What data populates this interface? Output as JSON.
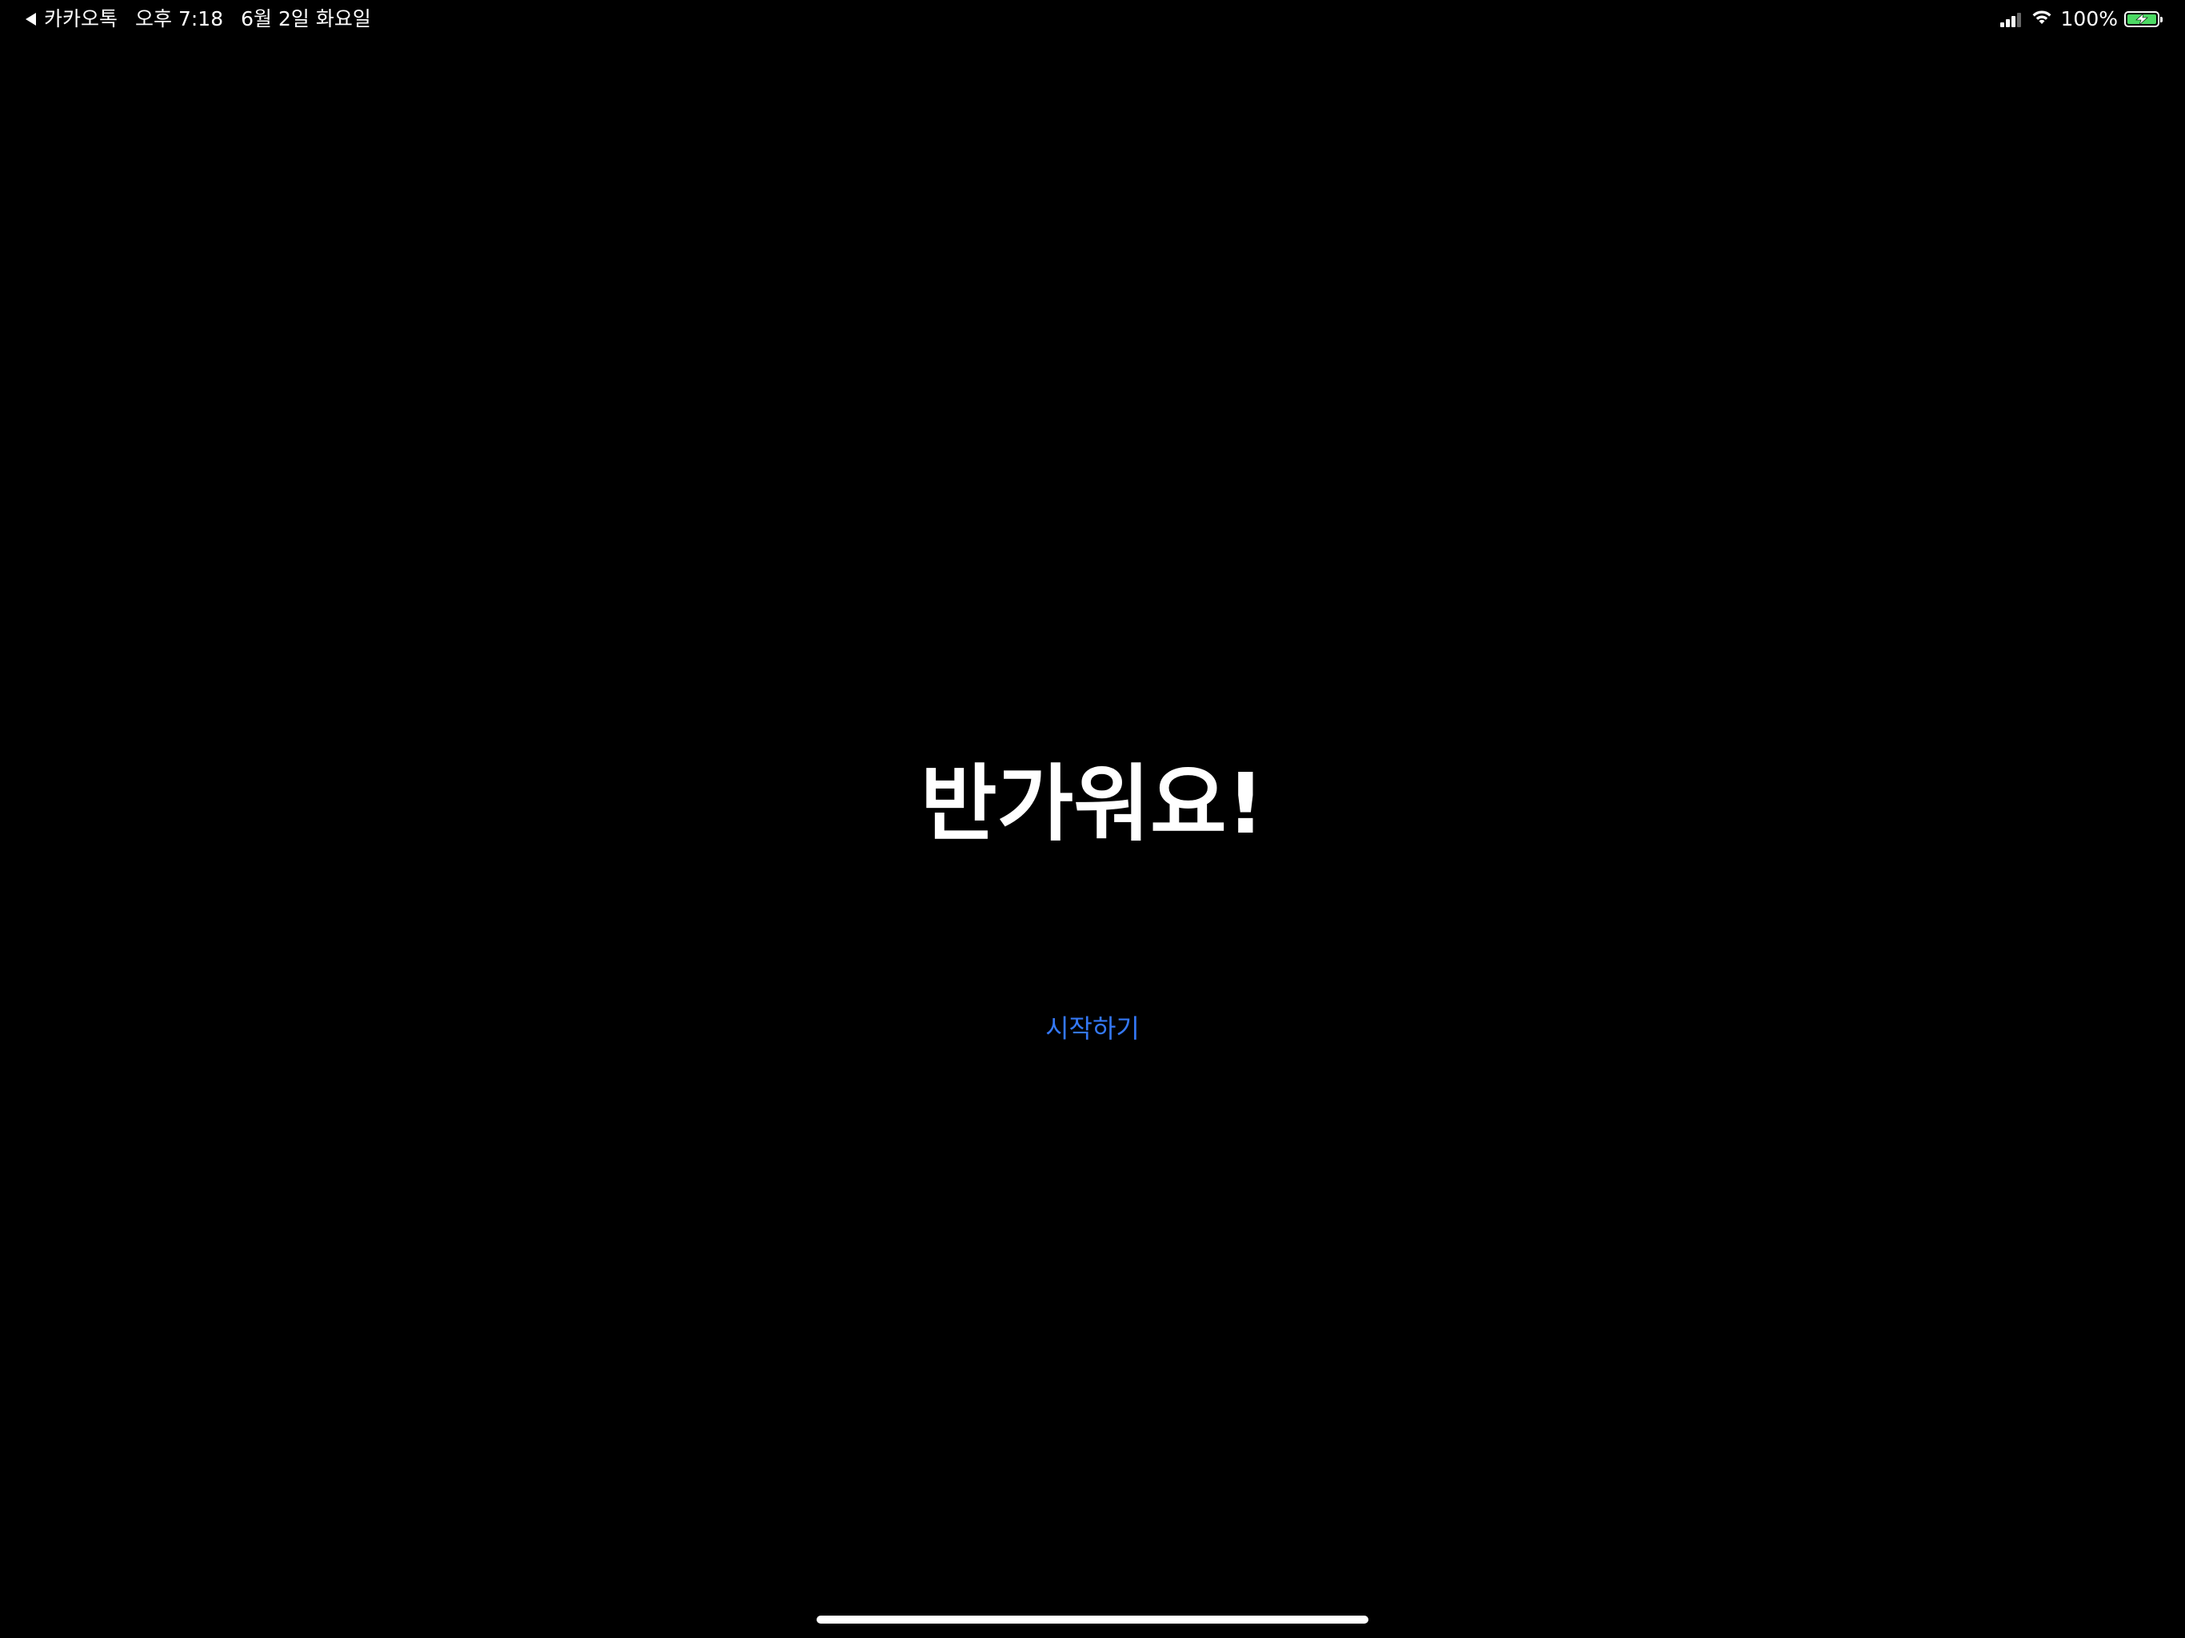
{
  "status_bar": {
    "back_app": "카카오톡",
    "time": "오후 7:18",
    "date": "6월 2일 화요일",
    "battery_percent": "100%",
    "battery_level": 1.0,
    "battery_color": "#4cd964",
    "charging": true,
    "icons": [
      "back-arrow-icon",
      "cellular-signal-icon",
      "wifi-icon",
      "battery-icon",
      "charging-bolt-icon"
    ]
  },
  "main": {
    "greeting": "반가워요!",
    "start_button": "시작하기",
    "accent_color": "#3478f6"
  }
}
